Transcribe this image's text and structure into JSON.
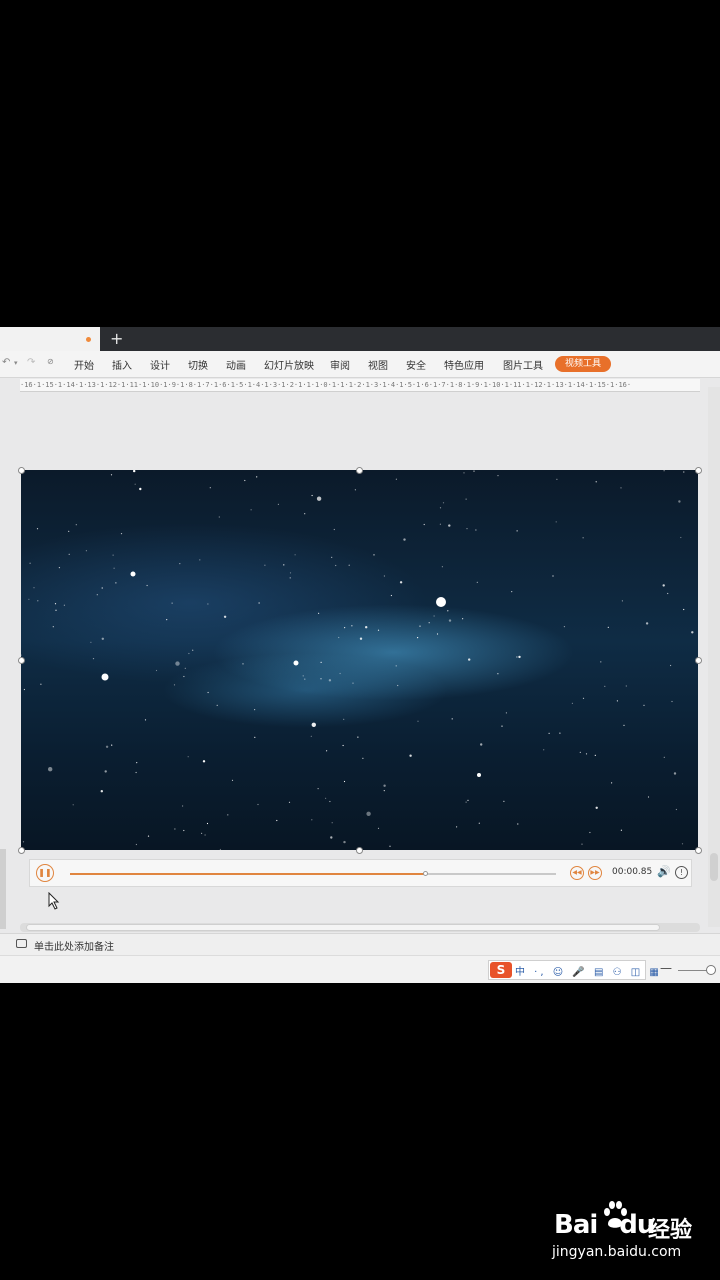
{
  "app": {
    "tab_add": "+",
    "quick_access": [
      "↶",
      "▾",
      "↷",
      "⊘"
    ],
    "menu": [
      {
        "label": "开始"
      },
      {
        "label": "插入"
      },
      {
        "label": "设计"
      },
      {
        "label": "切换"
      },
      {
        "label": "动画"
      },
      {
        "label": "幻灯片放映"
      },
      {
        "label": "审阅"
      },
      {
        "label": "视图"
      },
      {
        "label": "安全"
      },
      {
        "label": "特色应用"
      },
      {
        "label": "图片工具"
      }
    ],
    "active_tool": "视频工具",
    "ruler_text": "·16·1·15·1·14·1·13·1·12·1·11·1·10·1·9·1·8·1·7·1·6·1·5·1·4·1·3·1·2·1·1·1·0·1·1·1·2·1·3·1·4·1·5·1·6·1·7·1·8·1·9·1·10·1·11·1·12·1·13·1·14·1·15·1·16·"
  },
  "video_player": {
    "progress": 0.73,
    "time": "00:00.85",
    "pause_icon": "pause-icon",
    "rewind_icon": "rewind-icon",
    "forward_icon": "forward-icon",
    "volume_icon": "volume-icon",
    "info_icon": "info-icon"
  },
  "notes": {
    "placeholder": "单击此处添加备注"
  },
  "statusbar": {
    "ime_logo": "S",
    "ime_items": "中 ·, ☺ 🎤 ▤ ⚇ ◫ ▦",
    "zoom_minus": "—"
  },
  "watermark": {
    "brand": "Bai",
    "brand_suffix": "du",
    "cn": "经验",
    "url": "jingyan.baidu.com"
  },
  "colors": {
    "accent": "#e8702a",
    "progress": "#e0853f",
    "tabbar": "#2b2d31"
  }
}
